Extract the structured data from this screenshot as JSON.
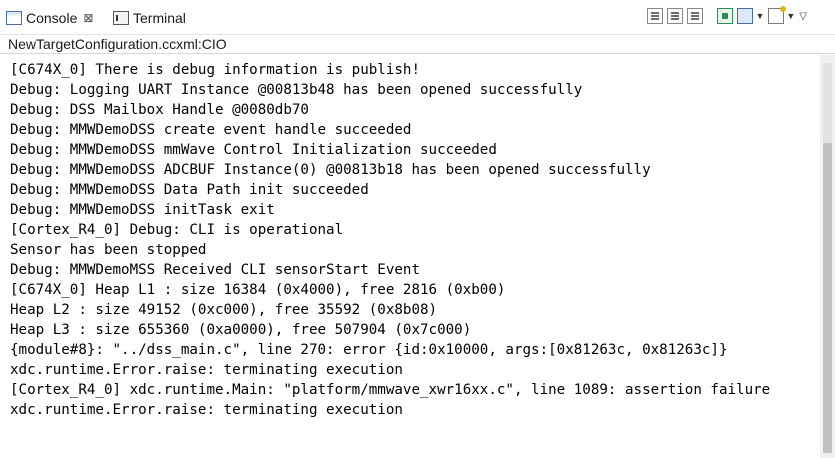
{
  "tabs": {
    "console_label": "Console",
    "console_close": "⊠",
    "terminal_label": "Terminal"
  },
  "toolbar": {
    "icons": [
      "clear-console-icon",
      "scroll-lock-icon",
      "word-wrap-icon",
      "pin-console-icon",
      "display-selected-console-icon",
      "open-console-icon",
      "view-menu-icon"
    ]
  },
  "console": {
    "title": "NewTargetConfiguration.ccxml:CIO",
    "lines": [
      "[C674X_0] There is debug information is publish!",
      "Debug: Logging UART Instance @00813b48 has been opened successfully",
      "Debug: DSS Mailbox Handle @0080db70",
      "Debug: MMWDemoDSS create event handle succeeded",
      "Debug: MMWDemoDSS mmWave Control Initialization succeeded",
      "Debug: MMWDemoDSS ADCBUF Instance(0) @00813b18 has been opened successfully",
      "Debug: MMWDemoDSS Data Path init succeeded",
      "Debug: MMWDemoDSS initTask exit",
      "[Cortex_R4_0] Debug: CLI is operational",
      "Sensor has been stopped",
      "Debug: MMWDemoMSS Received CLI sensorStart Event",
      "[C674X_0] Heap L1 : size 16384 (0x4000), free 2816 (0xb00)",
      "Heap L2 : size 49152 (0xc000), free 35592 (0x8b08)",
      "Heap L3 : size 655360 (0xa0000), free 507904 (0x7c000)",
      "{module#8}: \"../dss_main.c\", line 270: error {id:0x10000, args:[0x81263c, 0x81263c]}",
      "xdc.runtime.Error.raise: terminating execution",
      "[Cortex_R4_0] xdc.runtime.Main: \"platform/mmwave_xwr16xx.c\", line 1089: assertion failure",
      "xdc.runtime.Error.raise: terminating execution"
    ]
  },
  "colors": {
    "background": "#ffffff",
    "text": "#000000",
    "scroll_track": "#f0f0f0",
    "scroll_thumb": "#c2c2c2"
  }
}
